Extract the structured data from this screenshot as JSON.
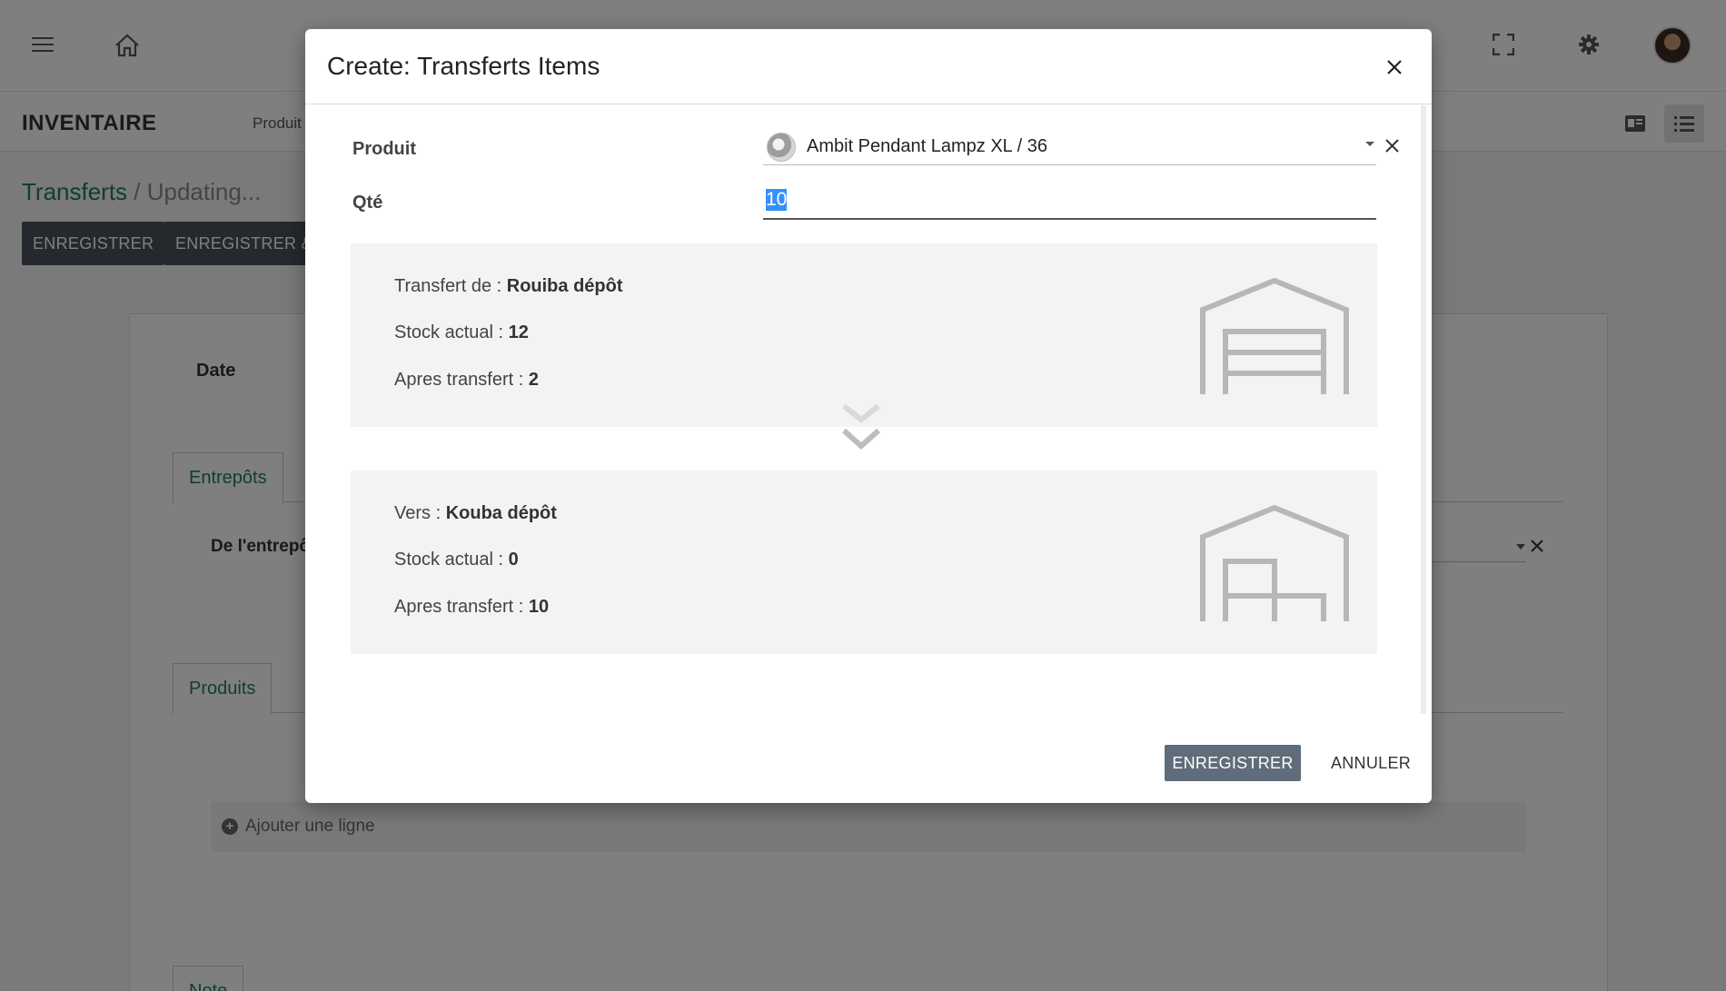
{
  "app": {
    "title": "INVENTAIRE",
    "subnav_first": "Produit",
    "breadcrumb": {
      "link": "Transferts",
      "separator": " / ",
      "current": "Updating..."
    },
    "buttons": {
      "save": "ENREGISTRER",
      "save_new": "ENREGISTRER &"
    },
    "form": {
      "date_label": "Date",
      "tab_entrepots": "Entrepôts",
      "from_warehouse_label": "De l'entrepô",
      "tab_produits": "Produits",
      "add_line": "Ajouter une ligne",
      "tab_note": "Note"
    },
    "icons": [
      "menu-icon",
      "home-icon",
      "fullscreen-icon",
      "gear-icon",
      "kanban-view-icon",
      "list-view-icon"
    ]
  },
  "modal": {
    "title": "Create: Transferts Items",
    "product_label": "Produit",
    "product_value": "Ambit Pendant Lampz XL / 36",
    "qty_label": "Qté",
    "qty_value": "10",
    "from": {
      "label": "Transfert de : ",
      "warehouse": "Rouiba dépôt",
      "stock_label": "Stock actual : ",
      "stock": "12",
      "after_label": "Apres transfert : ",
      "after": "2"
    },
    "to": {
      "label": "Vers : ",
      "warehouse": "Kouba dépôt",
      "stock_label": "Stock actual : ",
      "stock": "0",
      "after_label": "Apres transfert : ",
      "after": "10"
    },
    "save_label": "ENREGISTRER",
    "cancel_label": "ANNULER"
  },
  "colors": {
    "accent": "#1f7a6d",
    "dark_button": "#4a535d",
    "primary_button": "#5f6c79",
    "selection": "#3390ff"
  }
}
